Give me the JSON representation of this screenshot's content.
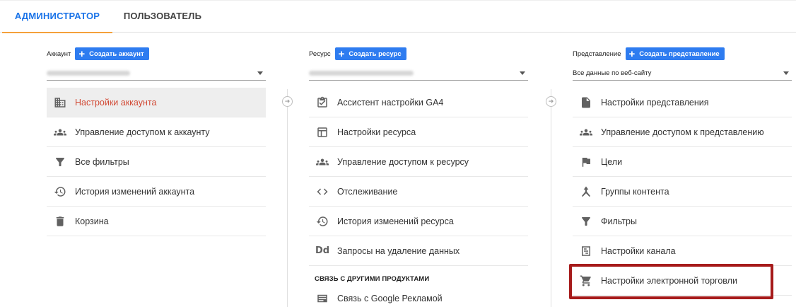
{
  "tabs": [
    {
      "label": "АДМИНИСТРАТОР",
      "active": true
    },
    {
      "label": "ПОЛЬЗОВАТЕЛЬ",
      "active": false
    }
  ],
  "account": {
    "label": "Аккаунт",
    "create_button": "Создать аккаунт",
    "items": [
      {
        "label": "Настройки аккаунта",
        "icon": "building-icon",
        "selected": true
      },
      {
        "label": "Управление доступом к аккаунту",
        "icon": "people-icon"
      },
      {
        "label": "Все фильтры",
        "icon": "filter-icon"
      },
      {
        "label": "История изменений аккаунта",
        "icon": "history-icon"
      },
      {
        "label": "Корзина",
        "icon": "trash-icon"
      }
    ]
  },
  "property": {
    "label": "Ресурс",
    "create_button": "Создать ресурс",
    "items": [
      {
        "label": "Ассистент настройки GA4",
        "icon": "clipboard-check-icon"
      },
      {
        "label": "Настройки ресурса",
        "icon": "layout-icon"
      },
      {
        "label": "Управление доступом к ресурсу",
        "icon": "people-icon"
      },
      {
        "label": "Отслеживание",
        "icon": "code-icon"
      },
      {
        "label": "История изменений ресурса",
        "icon": "history-icon"
      },
      {
        "label": "Запросы на удаление данных",
        "icon": "dd-icon",
        "glyph": "Dd"
      }
    ],
    "section_title": "СВЯЗЬ С ДРУГИМИ ПРОДУКТАМИ",
    "link_items": [
      {
        "label": "Связь с Google Рекламой",
        "icon": "ads-icon"
      }
    ]
  },
  "view": {
    "label": "Представление",
    "create_button": "Создать представление",
    "selected_value": "Все данные по веб-сайту",
    "items": [
      {
        "label": "Настройки представления",
        "icon": "document-icon"
      },
      {
        "label": "Управление доступом к представлению",
        "icon": "people-icon"
      },
      {
        "label": "Цели",
        "icon": "flag-icon"
      },
      {
        "label": "Группы контента",
        "icon": "content-group-icon"
      },
      {
        "label": "Фильтры",
        "icon": "filter-icon"
      },
      {
        "label": "Настройки канала",
        "icon": "channel-icon"
      },
      {
        "label": "Настройки электронной торговли",
        "icon": "cart-icon"
      }
    ]
  },
  "colors": {
    "accent_blue": "#2e7cf0",
    "tab_active": "#1a73e8",
    "tab_underline": "#f4a13a",
    "selected_text": "#d24a35",
    "highlight_border": "#a61b1b"
  }
}
